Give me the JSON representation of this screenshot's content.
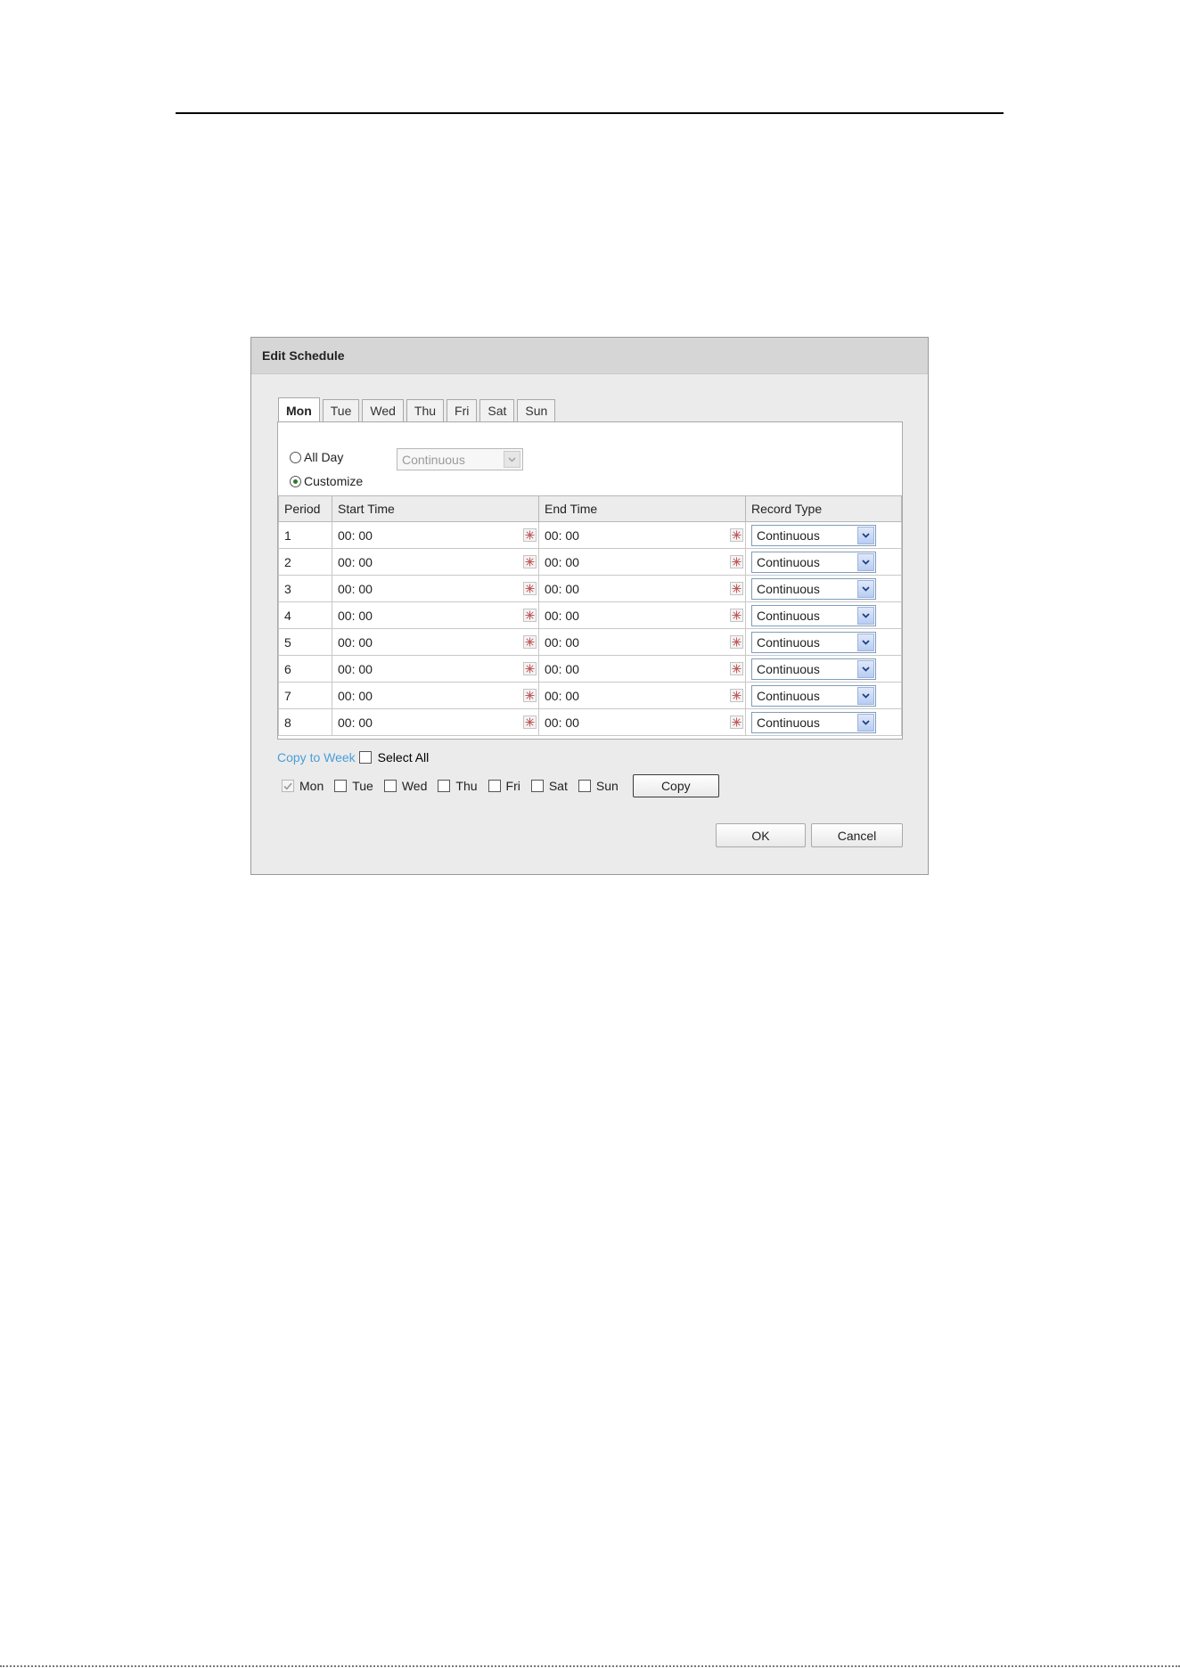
{
  "dialog": {
    "title": "Edit Schedule"
  },
  "tabs": [
    {
      "label": "Mon",
      "active": true
    },
    {
      "label": "Tue",
      "active": false
    },
    {
      "label": "Wed",
      "active": false
    },
    {
      "label": "Thu",
      "active": false
    },
    {
      "label": "Fri",
      "active": false
    },
    {
      "label": "Sat",
      "active": false
    },
    {
      "label": "Sun",
      "active": false
    }
  ],
  "mode": {
    "all_day_label": "All Day",
    "customize_label": "Customize",
    "selected": "customize",
    "all_day_select_value": "Continuous"
  },
  "table": {
    "headers": {
      "period": "Period",
      "start_time": "Start Time",
      "end_time": "End Time",
      "record_type": "Record Type"
    },
    "rows": [
      {
        "period": "1",
        "start": "00: 00",
        "end": "00: 00",
        "record_type": "Continuous"
      },
      {
        "period": "2",
        "start": "00: 00",
        "end": "00: 00",
        "record_type": "Continuous"
      },
      {
        "period": "3",
        "start": "00: 00",
        "end": "00: 00",
        "record_type": "Continuous"
      },
      {
        "period": "4",
        "start": "00: 00",
        "end": "00: 00",
        "record_type": "Continuous"
      },
      {
        "period": "5",
        "start": "00: 00",
        "end": "00: 00",
        "record_type": "Continuous"
      },
      {
        "period": "6",
        "start": "00: 00",
        "end": "00: 00",
        "record_type": "Continuous"
      },
      {
        "period": "7",
        "start": "00: 00",
        "end": "00: 00",
        "record_type": "Continuous"
      },
      {
        "period": "8",
        "start": "00: 00",
        "end": "00: 00",
        "record_type": "Continuous"
      }
    ]
  },
  "copy": {
    "link_label": "Copy to Week",
    "select_all_label": "Select All",
    "days": [
      {
        "label": "Mon",
        "checked": true,
        "disabled": true
      },
      {
        "label": "Tue",
        "checked": false,
        "disabled": false
      },
      {
        "label": "Wed",
        "checked": false,
        "disabled": false
      },
      {
        "label": "Thu",
        "checked": false,
        "disabled": false
      },
      {
        "label": "Fri",
        "checked": false,
        "disabled": false
      },
      {
        "label": "Sat",
        "checked": false,
        "disabled": false
      },
      {
        "label": "Sun",
        "checked": false,
        "disabled": false
      }
    ],
    "copy_button": "Copy"
  },
  "footer": {
    "ok_label": "OK",
    "cancel_label": "Cancel"
  },
  "colors": {
    "link": "#4a9ed8",
    "header_bg": "#d6d6d6",
    "dialog_bg": "#ebebeb",
    "radio_dot": "#2a7a2a"
  }
}
